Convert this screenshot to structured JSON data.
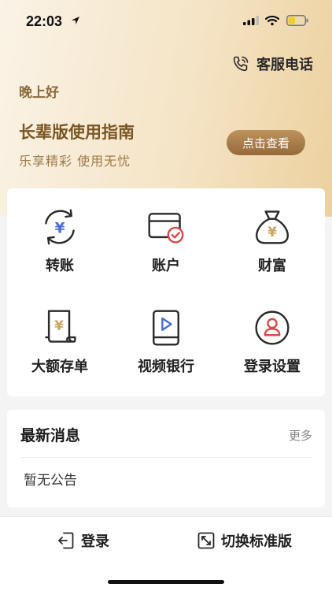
{
  "status_bar": {
    "time": "22:03"
  },
  "header": {
    "service_label": "客服电话",
    "greeting": "晚上好",
    "guide_title": "长辈版使用指南",
    "guide_subtitle": "乐享精彩  使用无忧",
    "guide_button": "点击查看"
  },
  "grid": {
    "items": [
      {
        "label": "转账",
        "icon": "transfer-icon"
      },
      {
        "label": "账户",
        "icon": "account-card-icon"
      },
      {
        "label": "财富",
        "icon": "money-bag-icon"
      },
      {
        "label": "大额存单",
        "icon": "deposit-certificate-icon"
      },
      {
        "label": "视频银行",
        "icon": "video-bank-icon"
      },
      {
        "label": "登录设置",
        "icon": "user-settings-icon"
      }
    ]
  },
  "news": {
    "title": "最新消息",
    "more": "更多",
    "empty": "暂无公告"
  },
  "bottom": {
    "login": "登录",
    "switch": "切换标准版"
  },
  "colors": {
    "brown_text": "#7a5624",
    "gold_button": "#a87b47",
    "accent_red": "#d94a4a",
    "accent_blue": "#4a6fd9"
  }
}
